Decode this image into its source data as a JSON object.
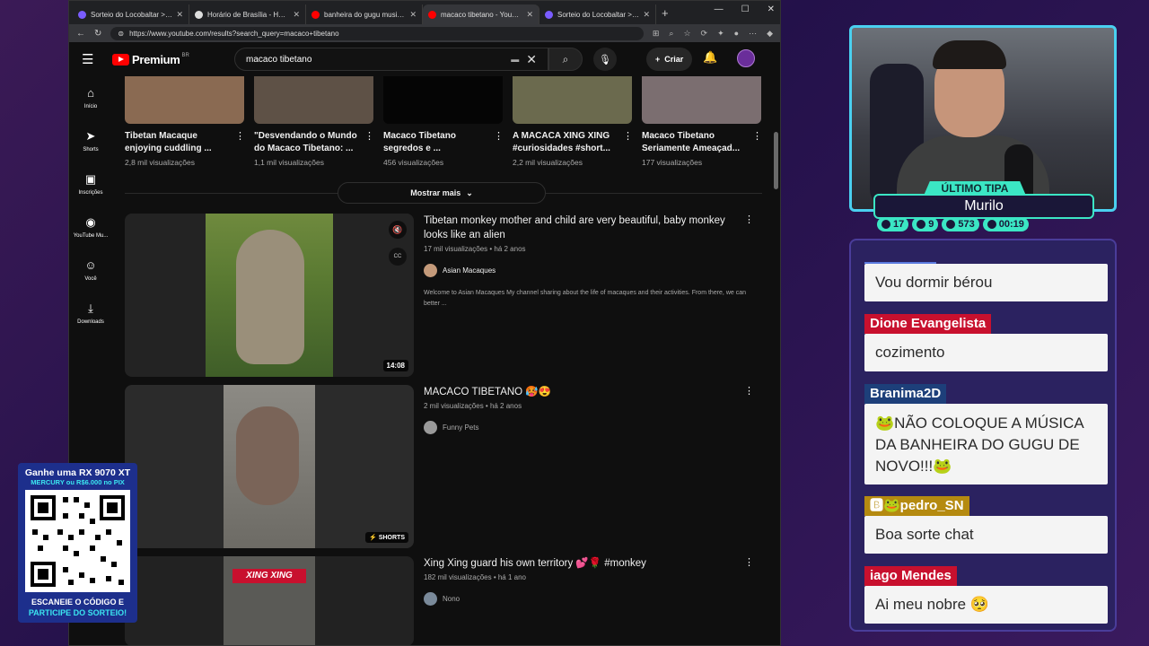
{
  "browser": {
    "tabs": [
      {
        "title": "Sorteio do Locobaltar > Dado...",
        "favicon_color": "#7a5cff",
        "active": false
      },
      {
        "title": "Horário de Brasília - Hora Cert...",
        "favicon_color": "#dddddd",
        "active": false
      },
      {
        "title": "banheira do gugu musica - Yo...",
        "favicon_color": "#ff0000",
        "active": false
      },
      {
        "title": "macaco tibetano - YouTube",
        "favicon_color": "#ff0000",
        "active": true
      },
      {
        "title": "Sorteio do Locobaltar > Sorte...",
        "favicon_color": "#7a5cff",
        "active": false
      }
    ],
    "url": "https://www.youtube.com/results?search_query=macaco+tibetano"
  },
  "youtube": {
    "logo_text": "Premium",
    "logo_country": "BR",
    "search_value": "macaco tibetano",
    "create_label": "Criar",
    "sidebar": [
      {
        "label": "Início",
        "icon": "home-icon",
        "glyph": "⌂"
      },
      {
        "label": "Shorts",
        "icon": "shorts-icon",
        "glyph": "➤"
      },
      {
        "label": "Inscrições",
        "icon": "subscriptions-icon",
        "glyph": "▣"
      },
      {
        "label": "YouTube Mu...",
        "icon": "music-icon",
        "glyph": "◉"
      },
      {
        "label": "Você",
        "icon": "you-icon",
        "glyph": "☺"
      },
      {
        "label": "Downloads",
        "icon": "download-icon",
        "glyph": "⤓"
      }
    ],
    "shelf": [
      {
        "title": "Tibetan Macaque enjoying cuddling ...",
        "meta": "2,8 mil visualizações",
        "thumb": "#8a6a52"
      },
      {
        "title": "\"Desvendando o Mundo do Macaco Tibetano: ...",
        "meta": "1,1 mil visualizações",
        "thumb": "#5e5146"
      },
      {
        "title": "Macaco Tibetano segredos e ...",
        "meta": "456 visualizações",
        "thumb": "#050505"
      },
      {
        "title": "A MACACA XING XING #curiosidades #short...",
        "meta": "2,2 mil visualizações",
        "thumb": "#6b6a4e"
      },
      {
        "title": "Macaco Tibetano Seriamente Ameaçad...",
        "meta": "177 visualizações",
        "thumb": "#7b6e70"
      }
    ],
    "show_more": "Mostrar mais",
    "videos": [
      {
        "title": "Tibetan monkey mother and child are very beautiful, baby monkey looks like an alien",
        "meta": "17 mil visualizações • há 2 anos",
        "channel": "Asian Macaques",
        "description": "Welcome to Asian Macaques My channel sharing about the life of macaques and their activities. From there, we can better ...",
        "duration": "14:08",
        "thumb": "#6f7a3e"
      },
      {
        "title": "MACACO TIBETANO 🥵😍",
        "meta": "2 mil visualizações • há 2 anos",
        "channel": "Funny Pets",
        "badge": "SHORTS",
        "thumb": "#707068"
      },
      {
        "title": "Xing Xing guard his own territory 💕🌹 #monkey",
        "meta": "182 mil visualizações • há 1 ano",
        "channel": "Nono",
        "thumb_label": "XING XING",
        "thumb": "#4a4a48"
      }
    ]
  },
  "overlay": {
    "tip_label": "ÚLTIMO TIPA",
    "tip_name": "Murilo",
    "stats": [
      "17",
      "9",
      "573",
      "00:19"
    ],
    "chat": [
      {
        "name": "",
        "text": "Vou dormir bérou",
        "color": ""
      },
      {
        "name": "Dione Evangelista",
        "text": "cozimento",
        "color": "#c8102e"
      },
      {
        "name": "Branima2D",
        "text": "🐸NÃO COLOQUE A MÚSICA DA BANHEIRA DO GUGU DE NOVO!!!🐸",
        "color": "#1d3f7a"
      },
      {
        "name": "🅱🐸pedro_SN",
        "text": "Boa sorte chat",
        "color": "#b58a10"
      },
      {
        "name": "iago Mendes",
        "text": "Ai meu nobre 🥺",
        "color": "#c8102e"
      }
    ],
    "promo": {
      "line1": "Ganhe uma RX 9070 XT",
      "line2": "MERCURY ou R$6.000 no PIX",
      "line3": "ESCANEIE O CÓDIGO E",
      "line4": "PARTICIPE DO SORTEIO!"
    }
  }
}
